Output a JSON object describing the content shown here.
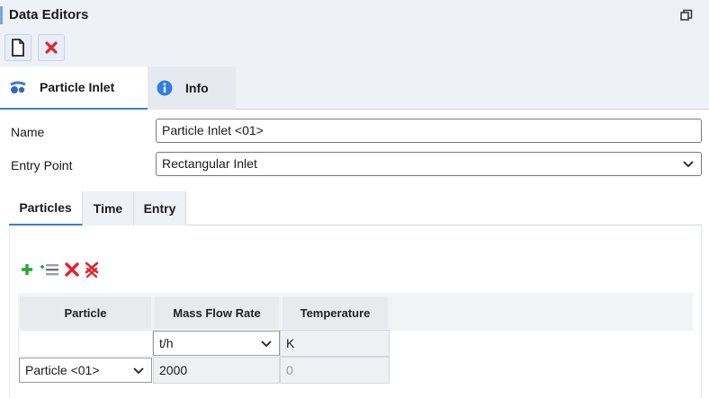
{
  "window": {
    "title": "Data Editors"
  },
  "toolbar": {
    "new_icon": "document-icon",
    "delete_icon": "close-red-icon"
  },
  "main_tabs": [
    {
      "label": "Particle Inlet",
      "icon": "particle-inlet-icon",
      "active": true
    },
    {
      "label": "Info",
      "icon": "info-icon",
      "active": false
    }
  ],
  "form": {
    "name_label": "Name",
    "name_value": "Particle Inlet <01>",
    "entry_label": "Entry Point",
    "entry_value": "Rectangular Inlet"
  },
  "sub_tabs": [
    {
      "label": "Particles",
      "active": true
    },
    {
      "label": "Time",
      "active": false
    },
    {
      "label": "Entry",
      "active": false
    }
  ],
  "grid_toolbar": [
    "add-icon",
    "insert-row-icon",
    "delete-icon",
    "delete-all-icon"
  ],
  "table": {
    "headers": [
      "Particle",
      "Mass Flow Rate",
      "Temperature"
    ],
    "units": {
      "mass_flow_rate": "t/h",
      "temperature": "K"
    },
    "rows": [
      {
        "particle": "Particle <01>",
        "mass_flow_rate": "2000",
        "temperature": "0"
      }
    ]
  },
  "colors": {
    "accent": "#3d7bd9",
    "delete": "#e0242f",
    "add": "#2aa63a"
  }
}
